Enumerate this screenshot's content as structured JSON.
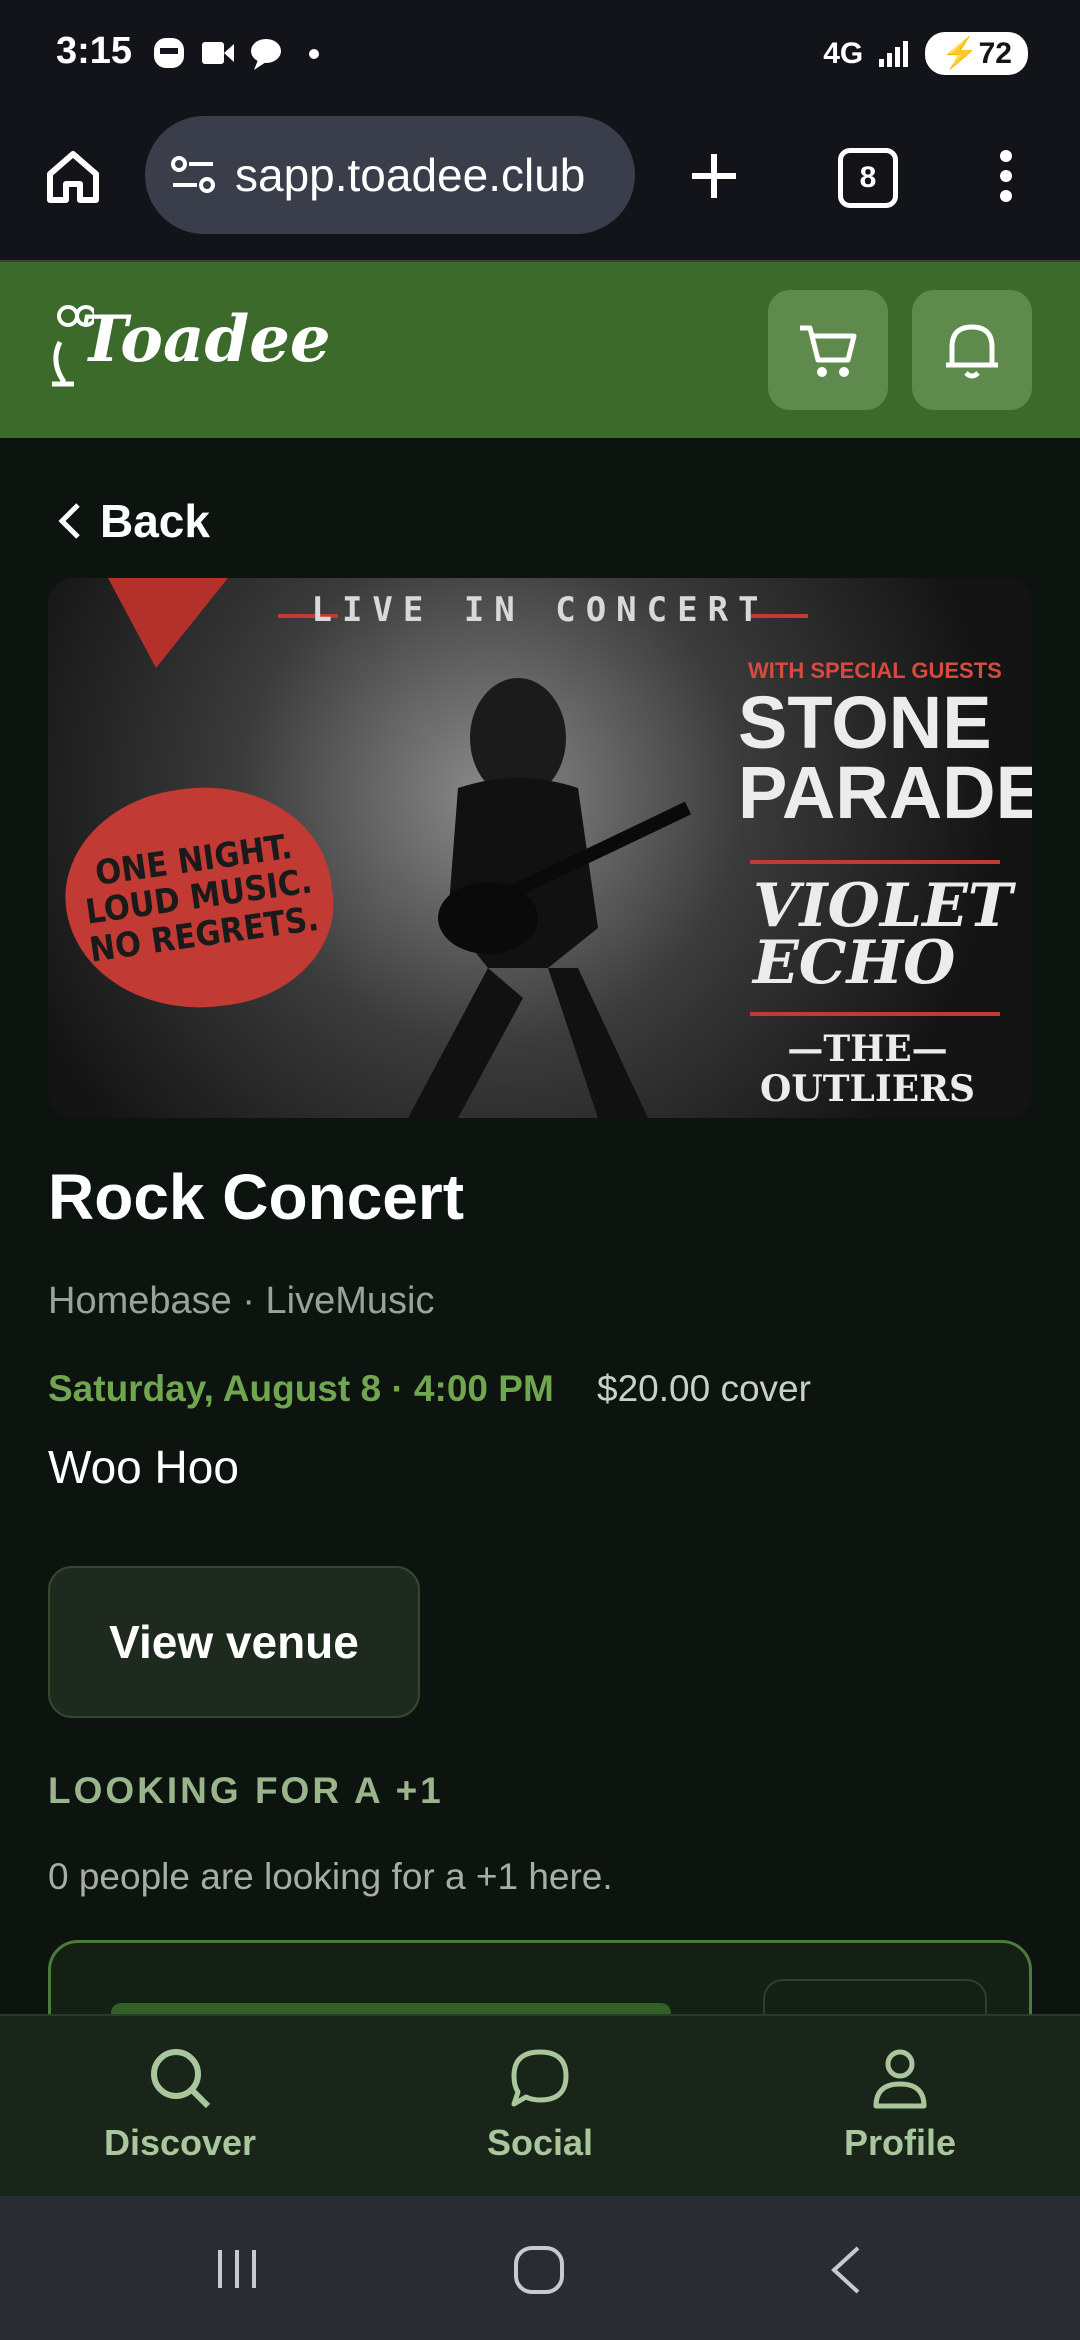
{
  "status_bar": {
    "time": "3:15",
    "network": "4G",
    "battery": "72"
  },
  "browser": {
    "url": "sapp.toadee.club",
    "tab_count": "8"
  },
  "app_header": {
    "logo_text": "Toadee",
    "cart_icon": "cart-icon",
    "bell_icon": "bell-icon"
  },
  "page": {
    "back_label": "Back",
    "poster": {
      "top_text": "LIVE IN CONCERT",
      "badge_lines": [
        "ONE NIGHT.",
        "LOUD MUSIC.",
        "NO REGRETS."
      ],
      "guests_label": "WITH SPECIAL GUESTS",
      "band1_line1": "STONE",
      "band1_line2": "PARADE",
      "band2_line1": "VIOLET",
      "band2_line2": "ECHO",
      "band3_line1": "—THE—",
      "band3_line2": "OUTLIERS"
    },
    "title": "Rock Concert",
    "meta": "Homebase · LiveMusic",
    "datetime": "Saturday, August 8 · 4:00 PM",
    "price": "$20.00 cover",
    "description": "Woo Hoo",
    "view_venue_label": "View venue",
    "plus_one_heading": "LOOKING FOR A +1",
    "plus_one_text": "0 people are looking for a +1 here."
  },
  "bottom_nav": {
    "items": [
      {
        "label": "Discover",
        "icon": "search-icon"
      },
      {
        "label": "Social",
        "icon": "chat-icon"
      },
      {
        "label": "Profile",
        "icon": "person-icon"
      }
    ]
  },
  "colors": {
    "brand_green": "#3b6a2a",
    "accent_green": "#6fa64f",
    "background": "#0d130e"
  }
}
